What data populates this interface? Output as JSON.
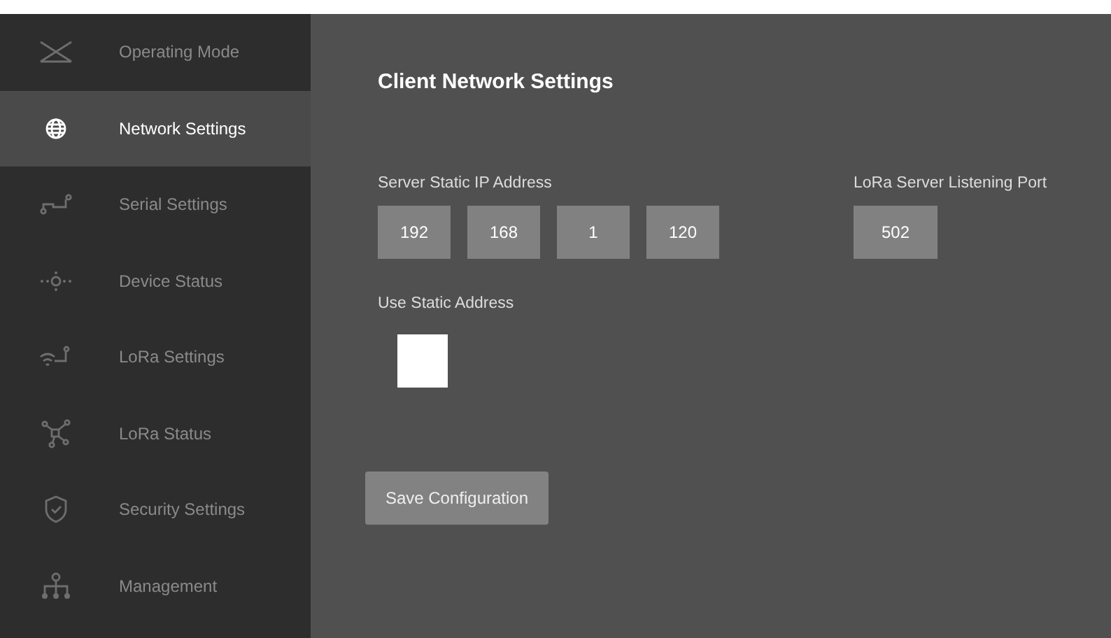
{
  "sidebar": {
    "items": [
      {
        "label": "Operating Mode",
        "selected": false
      },
      {
        "label": "Network Settings",
        "selected": true
      },
      {
        "label": "Serial Settings",
        "selected": false
      },
      {
        "label": "Device Status",
        "selected": false
      },
      {
        "label": "LoRa Settings",
        "selected": false
      },
      {
        "label": "LoRa Status",
        "selected": false
      },
      {
        "label": "Security Settings",
        "selected": false
      },
      {
        "label": "Management",
        "selected": false
      }
    ]
  },
  "main": {
    "title": "Client Network Settings",
    "ip": {
      "label": "Server Static IP Address",
      "octets": [
        "192",
        "168",
        "1",
        "120"
      ]
    },
    "port": {
      "label": "LoRa Server Listening Port",
      "value": "502"
    },
    "static": {
      "label": "Use Static Address",
      "checked": false
    },
    "save_button": "Save Configuration"
  }
}
